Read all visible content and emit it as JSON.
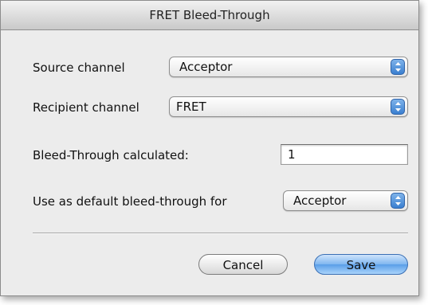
{
  "window": {
    "title": "FRET Bleed-Through"
  },
  "form": {
    "source_label": "Source channel",
    "source_value": "Acceptor",
    "recipient_label": "Recipient channel",
    "recipient_value": "FRET",
    "bleed_label": "Bleed-Through calculated:",
    "bleed_value": "1",
    "default_label": "Use as default bleed-through for",
    "default_value": "Acceptor"
  },
  "buttons": {
    "cancel": "Cancel",
    "save": "Save"
  },
  "colors": {
    "accent": "#5a9ee8",
    "background": "#ececec"
  },
  "icons": {
    "popup_arrows": "up-down-arrows-icon"
  }
}
